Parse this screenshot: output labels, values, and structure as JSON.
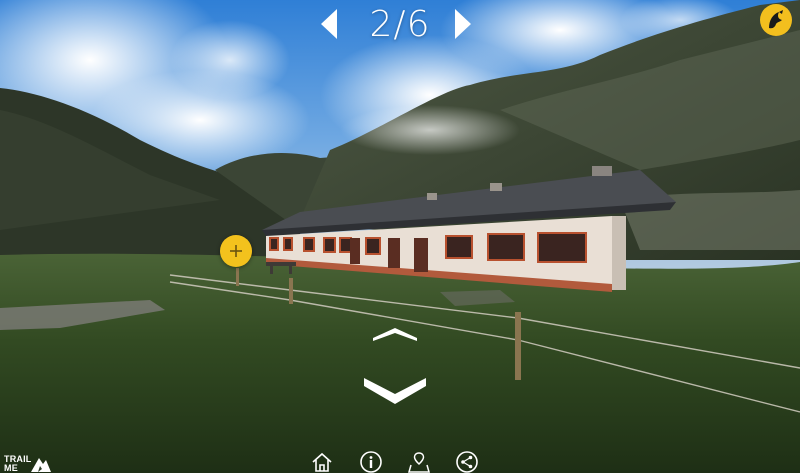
{
  "viewer": {
    "counter": "2/6"
  },
  "brand": {
    "line1": "TRAIL",
    "line2": "ME"
  },
  "icons": {
    "prev": "chevron-left-icon",
    "next": "chevron-right-icon",
    "logo": "trailme-logo-icon",
    "hotspot": "plus-icon",
    "look_up": "chevron-up-icon",
    "look_down": "chevron-down-icon",
    "home": "home-icon",
    "info": "info-icon",
    "map": "map-pin-icon",
    "share": "share-icon"
  },
  "colors": {
    "accent": "#f3c21d",
    "overlay_text": "#ffffff"
  }
}
